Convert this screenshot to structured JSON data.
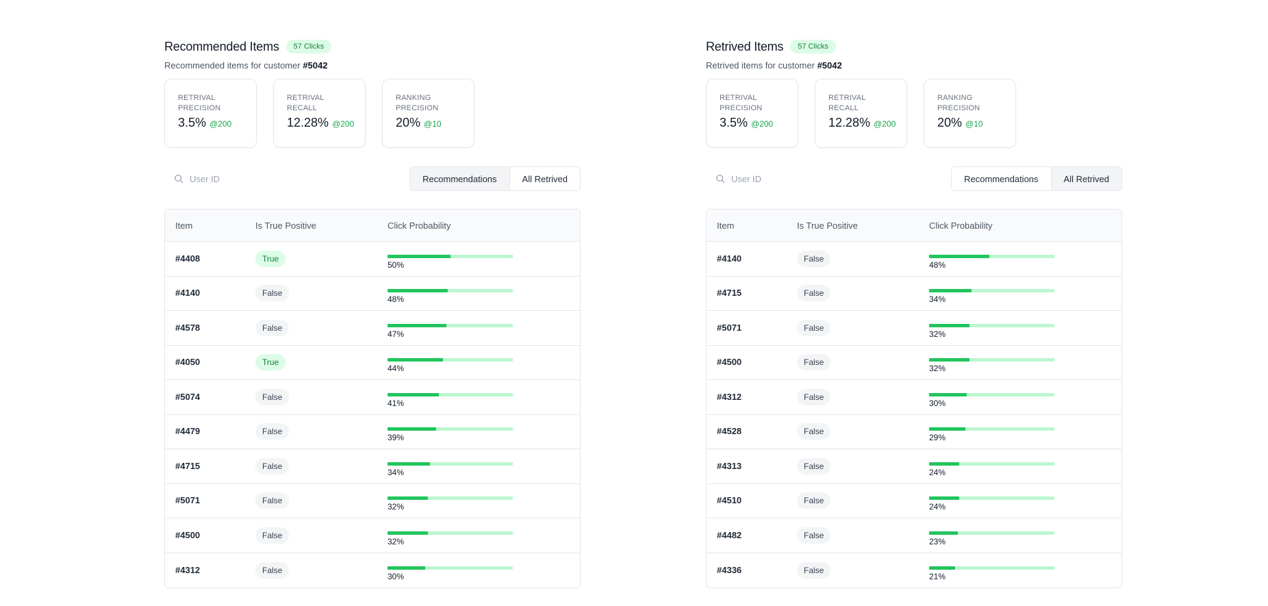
{
  "colors": {
    "accent": "#22c55e",
    "accent_light": "#bbf7d0",
    "badge_bg": "#dcfce7",
    "badge_text": "#15803d"
  },
  "panels": [
    {
      "title": "Recommended Items",
      "clicks_badge": "57 Clicks",
      "subtitle_prefix": "Recommended items for customer",
      "customer_id": "#5042",
      "metrics": [
        {
          "label_line1": "RETRIVAL",
          "label_line2": "PRECISION",
          "value": "3.5%",
          "at": "@200"
        },
        {
          "label_line1": "RETRIVAL",
          "label_line2": "RECALL",
          "value": "12.28%",
          "at": "@200"
        },
        {
          "label_line1": "RANKING",
          "label_line2": "PRECISION",
          "value": "20%",
          "at": "@10"
        }
      ],
      "search_placeholder": "User ID",
      "search_icon": "search-icon",
      "toggle": {
        "options": [
          "Recommendations",
          "All Retrived"
        ],
        "active": 0
      },
      "table": {
        "headers": [
          "Item",
          "Is True Positive",
          "Click Probability"
        ],
        "rows": [
          {
            "item": "#4408",
            "positive": "True",
            "prob": 0.5,
            "prob_text": "50%"
          },
          {
            "item": "#4140",
            "positive": "False",
            "prob": 0.48,
            "prob_text": "48%"
          },
          {
            "item": "#4578",
            "positive": "False",
            "prob": 0.47,
            "prob_text": "47%"
          },
          {
            "item": "#4050",
            "positive": "True",
            "prob": 0.44,
            "prob_text": "44%"
          },
          {
            "item": "#5074",
            "positive": "False",
            "prob": 0.41,
            "prob_text": "41%"
          },
          {
            "item": "#4479",
            "positive": "False",
            "prob": 0.39,
            "prob_text": "39%"
          },
          {
            "item": "#4715",
            "positive": "False",
            "prob": 0.34,
            "prob_text": "34%"
          },
          {
            "item": "#5071",
            "positive": "False",
            "prob": 0.32,
            "prob_text": "32%"
          },
          {
            "item": "#4500",
            "positive": "False",
            "prob": 0.32,
            "prob_text": "32%"
          },
          {
            "item": "#4312",
            "positive": "False",
            "prob": 0.3,
            "prob_text": "30%"
          }
        ]
      }
    },
    {
      "title": "Retrived Items",
      "clicks_badge": "57 Clicks",
      "subtitle_prefix": "Retrived items for customer",
      "customer_id": "#5042",
      "metrics": [
        {
          "label_line1": "RETRIVAL",
          "label_line2": "PRECISION",
          "value": "3.5%",
          "at": "@200"
        },
        {
          "label_line1": "RETRIVAL",
          "label_line2": "RECALL",
          "value": "12.28%",
          "at": "@200"
        },
        {
          "label_line1": "RANKING",
          "label_line2": "PRECISION",
          "value": "20%",
          "at": "@10"
        }
      ],
      "search_placeholder": "User ID",
      "search_icon": "search-icon",
      "toggle": {
        "options": [
          "Recommendations",
          "All Retrived"
        ],
        "active": 1
      },
      "table": {
        "headers": [
          "Item",
          "Is True Positive",
          "Click Probability"
        ],
        "rows": [
          {
            "item": "#4140",
            "positive": "False",
            "prob": 0.48,
            "prob_text": "48%"
          },
          {
            "item": "#4715",
            "positive": "False",
            "prob": 0.34,
            "prob_text": "34%"
          },
          {
            "item": "#5071",
            "positive": "False",
            "prob": 0.32,
            "prob_text": "32%"
          },
          {
            "item": "#4500",
            "positive": "False",
            "prob": 0.32,
            "prob_text": "32%"
          },
          {
            "item": "#4312",
            "positive": "False",
            "prob": 0.3,
            "prob_text": "30%"
          },
          {
            "item": "#4528",
            "positive": "False",
            "prob": 0.29,
            "prob_text": "29%"
          },
          {
            "item": "#4313",
            "positive": "False",
            "prob": 0.24,
            "prob_text": "24%"
          },
          {
            "item": "#4510",
            "positive": "False",
            "prob": 0.24,
            "prob_text": "24%"
          },
          {
            "item": "#4482",
            "positive": "False",
            "prob": 0.23,
            "prob_text": "23%"
          },
          {
            "item": "#4336",
            "positive": "False",
            "prob": 0.21,
            "prob_text": "21%"
          }
        ]
      }
    }
  ]
}
